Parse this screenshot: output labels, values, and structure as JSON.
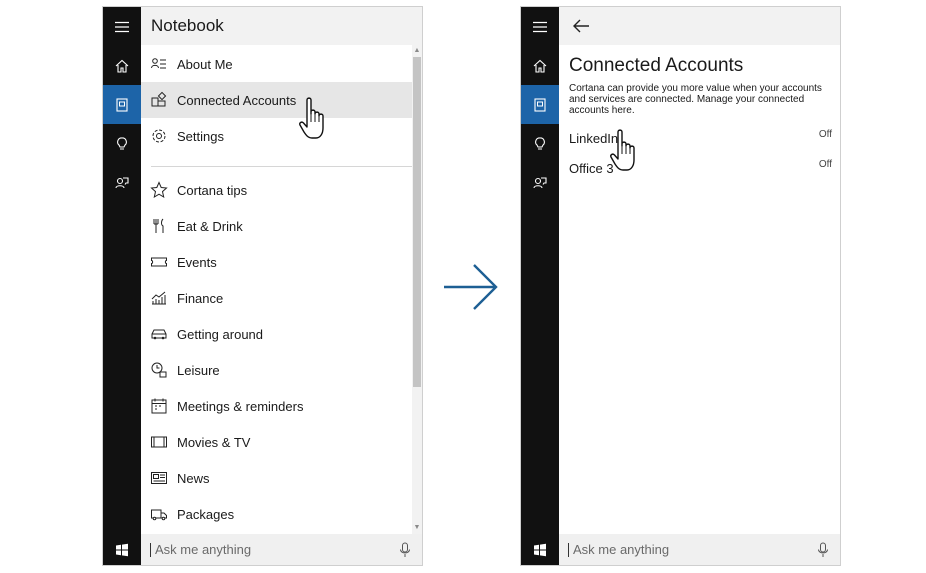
{
  "notebook": {
    "header_title": "Notebook",
    "menu_items": [
      {
        "label": "About Me",
        "icon": "about-me-icon"
      },
      {
        "label": "Connected Accounts",
        "icon": "connected-accounts-icon"
      },
      {
        "label": "Settings",
        "icon": "gear-icon"
      },
      {
        "label": "Cortana tips",
        "icon": "star-icon"
      },
      {
        "label": "Eat & Drink",
        "icon": "fork-knife-icon"
      },
      {
        "label": "Events",
        "icon": "ticket-icon"
      },
      {
        "label": "Finance",
        "icon": "finance-chart-icon"
      },
      {
        "label": "Getting around",
        "icon": "car-icon"
      },
      {
        "label": "Leisure",
        "icon": "leisure-icon"
      },
      {
        "label": "Meetings & reminders",
        "icon": "calendar-icon"
      },
      {
        "label": "Movies & TV",
        "icon": "film-icon"
      },
      {
        "label": "News",
        "icon": "newspaper-icon"
      },
      {
        "label": "Packages",
        "icon": "truck-icon"
      }
    ],
    "search_placeholder": "Ask me anything"
  },
  "connected": {
    "title": "Connected Accounts",
    "description": "Cortana can provide you more value when your accounts and services are connected. Manage your connected accounts here.",
    "accounts": [
      {
        "name": "LinkedIn",
        "status": "Off"
      },
      {
        "name": "Office 3",
        "status": "Off"
      }
    ],
    "search_placeholder": "Ask me anything"
  },
  "colors": {
    "rail": "#111111",
    "active": "#1d64a8",
    "header": "#f2f2f2",
    "hover": "#e6e6e6",
    "arrow": "#1d5f94"
  }
}
